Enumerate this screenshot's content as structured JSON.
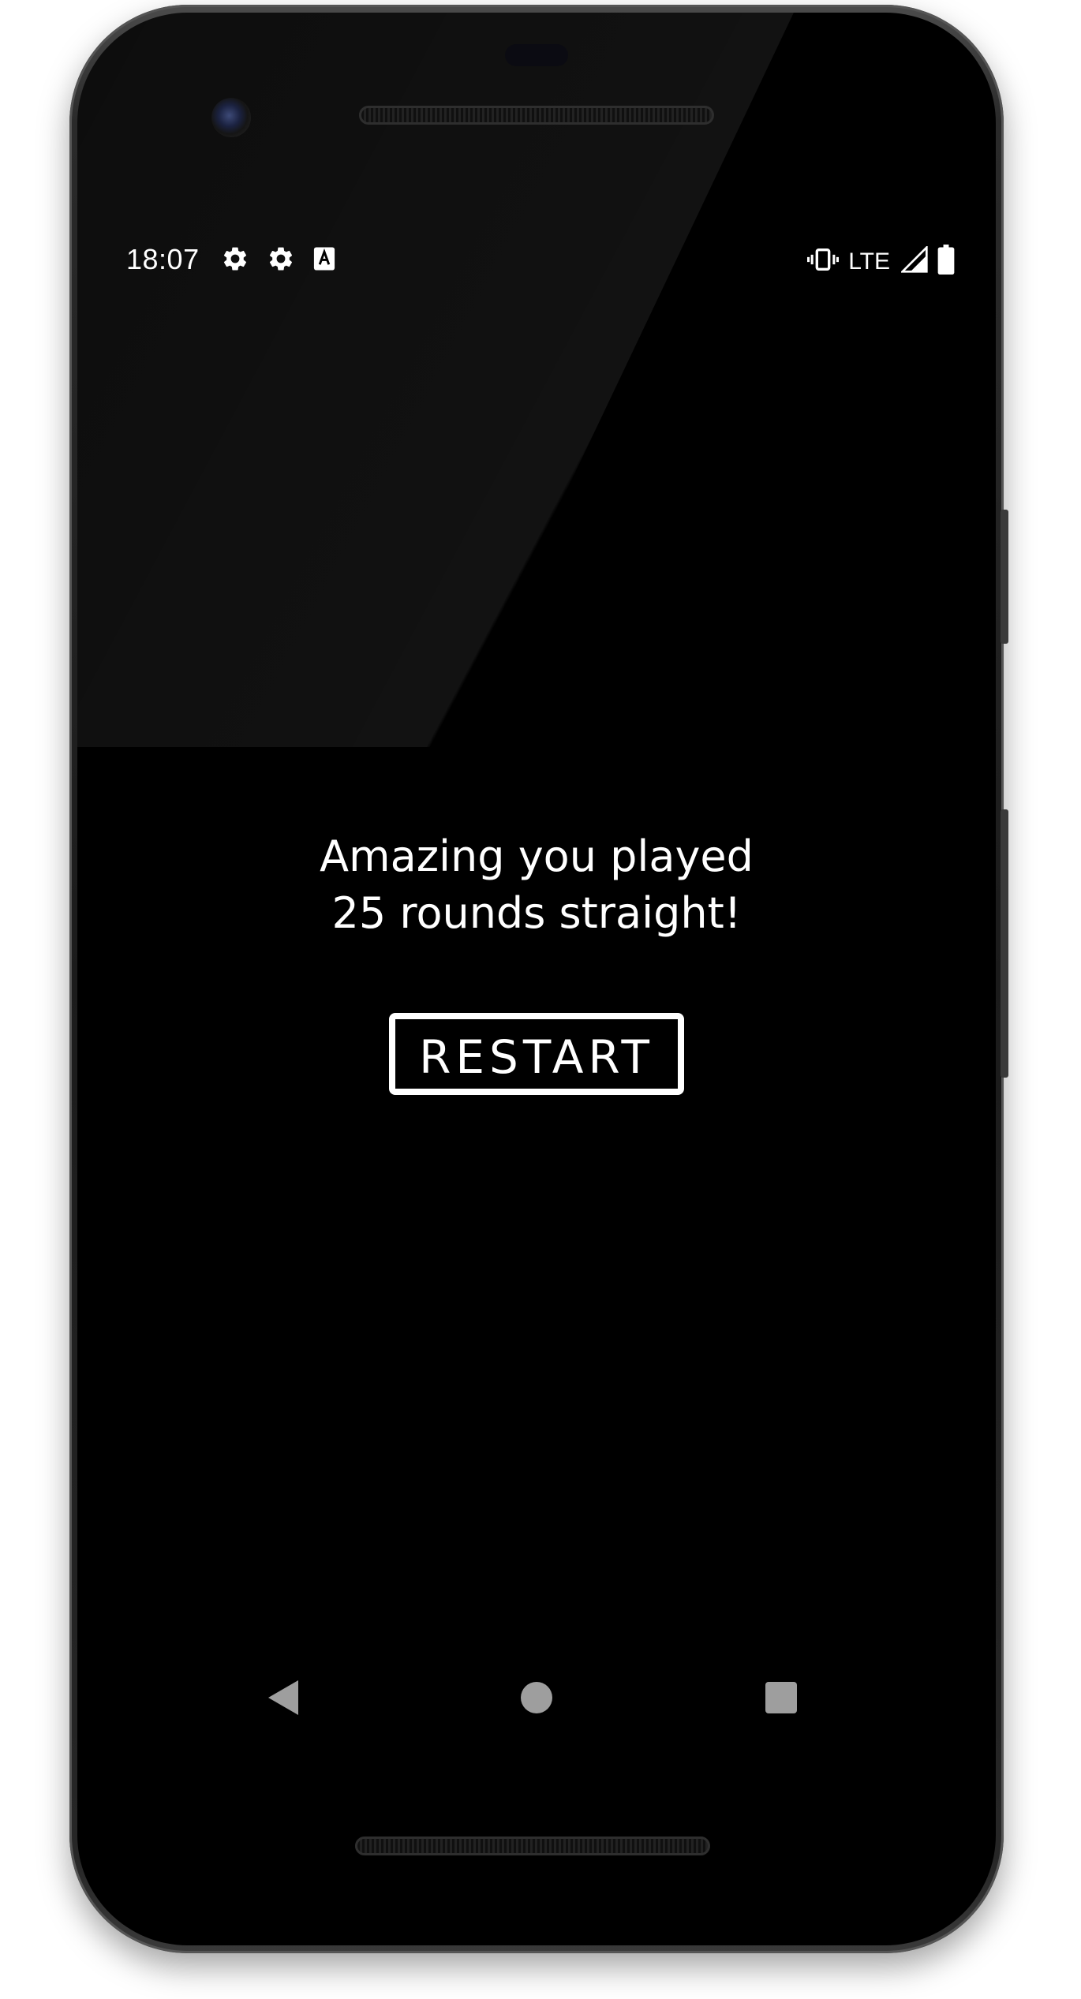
{
  "status_bar": {
    "time": "18:07",
    "left_icons": [
      "gear-icon",
      "gear-icon",
      "accessibility-a-icon"
    ],
    "network_label": "LTE",
    "right_icons": [
      "vibrate-icon",
      "signal-icon",
      "battery-icon"
    ]
  },
  "game_over": {
    "message_line1": "Amazing you played",
    "message_line2": "25 rounds straight!",
    "restart_label": "RESTART"
  },
  "nav_bar": {
    "buttons": [
      "back-icon",
      "home-icon",
      "recents-icon"
    ]
  },
  "colors": {
    "screen_background": "#000000",
    "text": "#ffffff",
    "nav_buttons": "#9e9e9e"
  }
}
